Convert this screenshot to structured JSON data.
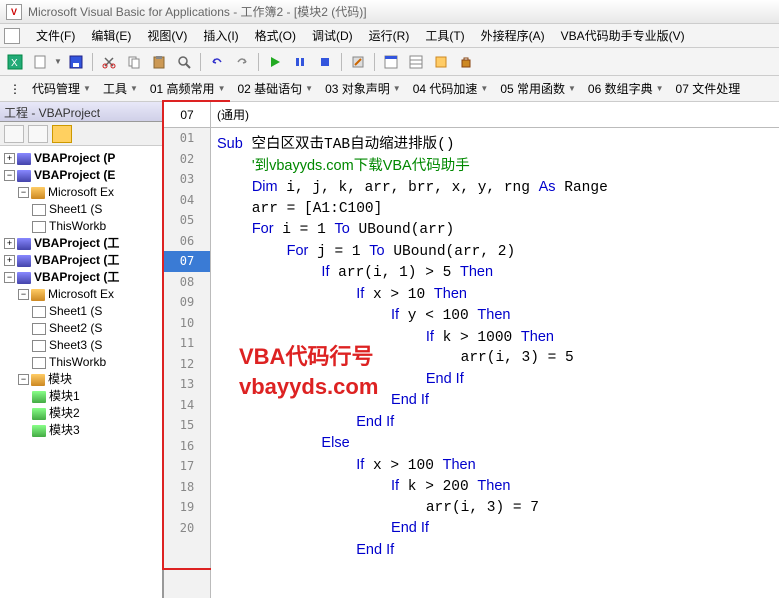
{
  "title": "Microsoft Visual Basic for Applications - 工作簿2 - [模块2 (代码)]",
  "menu": {
    "file": "文件(F)",
    "edit": "编辑(E)",
    "view": "视图(V)",
    "insert": "插入(I)",
    "format": "格式(O)",
    "debug": "调试(D)",
    "run": "运行(R)",
    "tools": "工具(T)",
    "addins": "外接程序(A)",
    "vba": "VBA代码助手专业版(V)"
  },
  "toolbar2": {
    "i0": "代码管理",
    "i1": "工具",
    "i2": "01 高频常用",
    "i3": "02 基础语句",
    "i4": "03 对象声明",
    "i5": "04 代码加速",
    "i6": "05 常用函数",
    "i7": "06 数组字典",
    "i8": "07 文件处理"
  },
  "project": {
    "title": "工程 - VBAProject",
    "n0": "VBAProject (P",
    "n1": "VBAProject (E",
    "n2": "Microsoft Ex",
    "n3": "Sheet1 (S",
    "n4": "ThisWorkb",
    "n5": "VBAProject (工",
    "n6": "VBAProject (工",
    "n7": "VBAProject (工",
    "n8": "Microsoft Ex",
    "n9": "Sheet1 (S",
    "n10": "Sheet2 (S",
    "n11": "Sheet3 (S",
    "n12": "ThisWorkb",
    "n13": "模块",
    "n14": "模块1",
    "n15": "模块2",
    "n16": "模块3"
  },
  "gutter": {
    "head": "07",
    "lines": [
      "01",
      "02",
      "03",
      "04",
      "05",
      "06",
      "07",
      "08",
      "09",
      "10",
      "11",
      "12",
      "13",
      "14",
      "15",
      "16",
      "17",
      "18",
      "19",
      "20"
    ],
    "current": "07"
  },
  "codehead": "(通用)",
  "watermark": {
    "l1": "VBA代码行号",
    "l2": "vbayyds.com"
  },
  "code": {
    "sub": "Sub",
    "name": "空白区双击TAB自动缩进排版",
    "paren": "()",
    "comment": "'到vbayyds.com下载VBA代码助手",
    "dim": "Dim",
    "dimvars": " i, j, k, arr, brr, x, y, rng ",
    "as": "As",
    "range": " Range",
    "arr": "arr = [A1:C100]",
    "for": "For",
    "to": "To",
    "ub": " UBound",
    "f1a": " i = 1 ",
    "f1b": "(arr)",
    "f2a": " j = 1 ",
    "f2b": "(arr, 2)",
    "if": "If",
    "then": "Then",
    "else": "Else",
    "endif": "End If",
    "c1": " arr(i, 1) > 5 ",
    "c2": " x > 10 ",
    "c3": " y < 100 ",
    "c4": " k > 1000 ",
    "a1": "arr(i, 3) = 5",
    "c5": " x > 100 ",
    "c6": " k > 200 ",
    "a2": "arr(i, 3) = 7"
  },
  "chart_data": null
}
